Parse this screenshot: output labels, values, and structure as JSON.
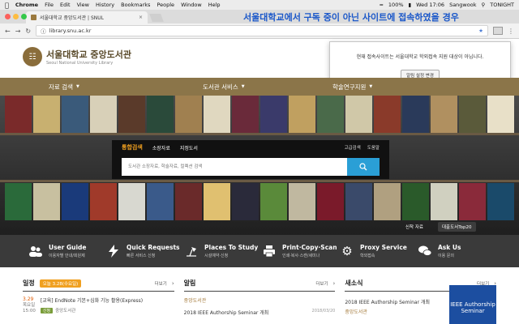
{
  "menubar": {
    "app": "Chrome",
    "items": [
      "File",
      "Edit",
      "View",
      "History",
      "Bookmarks",
      "People",
      "Window",
      "Help"
    ],
    "battery": "100%",
    "clock": "Wed 17:06",
    "user": "Sangwook",
    "extra": "TONIGHT"
  },
  "browser": {
    "tab_title": "서울대학교 중앙도서관 | SNUL",
    "url": "library.snu.ac.kr"
  },
  "caption": "서울대학교에서 구독 중이 아닌 사이트에 접속하였을 경우",
  "logo": {
    "title": "서울대학교 중앙도서관",
    "subtitle": "Seoul National University Library"
  },
  "popup": {
    "message": "현재 접속사이트는 서울대학교 학외접속 지원 대상이 아닙니다.",
    "button": "알림 설정 변경"
  },
  "nav": {
    "items": [
      "자료 검색",
      "도서관 서비스",
      "학술연구지원"
    ]
  },
  "search": {
    "tabs": [
      "통합검색",
      "소장자료",
      "지정도서"
    ],
    "links": [
      "고급검색",
      "도움말"
    ],
    "placeholder": "도서관 소장자료, 학술자료, 컬렉션 검색"
  },
  "hero": {
    "new_books": "신착 자료",
    "top20": "대출도서Top20"
  },
  "services": [
    {
      "title": "User Guide",
      "sub": "이용자별 안내/회원제"
    },
    {
      "title": "Quick Requests",
      "sub": "빠른 서비스 신청"
    },
    {
      "title": "Places To Study",
      "sub": "시설예약·신청"
    },
    {
      "title": "Print·Copy·Scan",
      "sub": "인쇄·복사·스캔/세미나"
    },
    {
      "title": "Proxy Service",
      "sub": "학외접속"
    },
    {
      "title": "Ask Us",
      "sub": "이용 문의"
    }
  ],
  "schedule": {
    "title": "일정",
    "today": "오늘 3.28(수요일)",
    "more": "더보기",
    "date": "3.29",
    "weekday": "목요일",
    "time": "15:00",
    "event": "[교육] EndNote 기본+심화 기능 활용(Express)",
    "badge": "신청",
    "org": "중앙도서관"
  },
  "notice": {
    "title": "알림",
    "more": "더보기",
    "org": "중앙도서관",
    "item": "2018 IEEE Authorship Seminar 개최",
    "date": "2018/03/20"
  },
  "news": {
    "title": "새소식",
    "more": "더보기",
    "item": "2018 IEEE Authorship Seminar 개최",
    "org": "중앙도서관",
    "promo_line1": "IEEE Authorship",
    "promo_line2": "Seminar"
  }
}
